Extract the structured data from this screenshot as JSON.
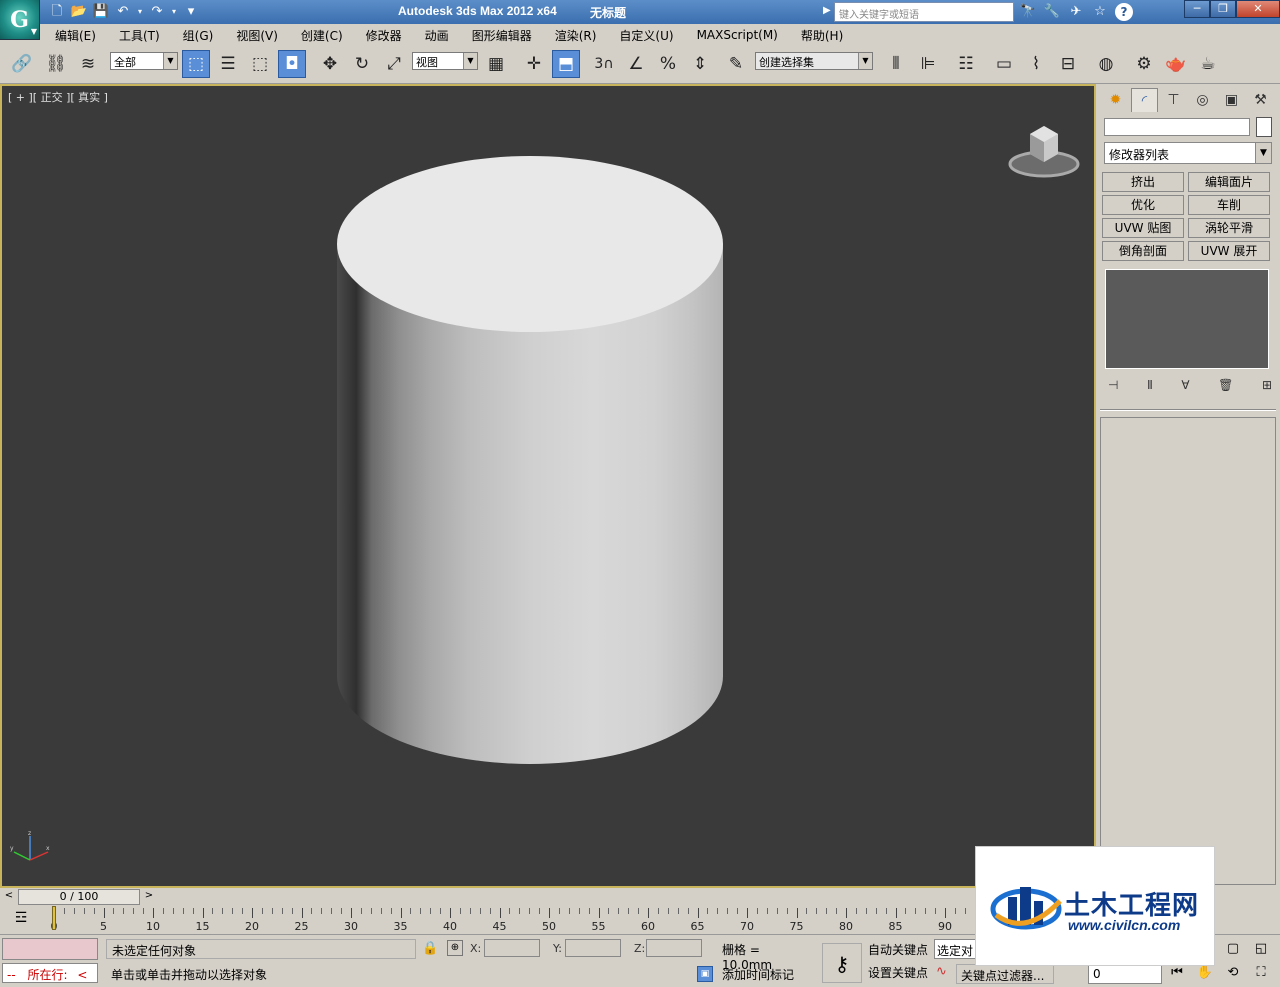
{
  "app": {
    "title": "Autodesk 3ds Max  2012 x64",
    "document": "无标题",
    "search_placeholder": "键入关键字或短语",
    "logo": "G"
  },
  "menu": [
    "编辑(E)",
    "工具(T)",
    "组(G)",
    "视图(V)",
    "创建(C)",
    "修改器",
    "动画",
    "图形编辑器",
    "渲染(R)",
    "自定义(U)",
    "MAXScript(M)",
    "帮助(H)"
  ],
  "toolbar": {
    "filter_value": "全部",
    "ref_coord_value": "视图",
    "named_selection_value": "创建选择集",
    "snap_value": "3"
  },
  "viewport": {
    "label": "[ + ][ 正交 ][ 真实 ]",
    "object": "cylinder",
    "background": "#3a3a3a",
    "active_border": "#c8b45a"
  },
  "command_panel": {
    "modifier_list": "修改器列表",
    "modifier_buttons": [
      "挤出",
      "编辑面片",
      "优化",
      "车削",
      "UVW 贴图",
      "涡轮平滑",
      "倒角剖面",
      "UVW 展开"
    ]
  },
  "timeline": {
    "position": "0 / 100",
    "current_frame": 0,
    "tick_labels": [
      "0",
      "5",
      "10",
      "15",
      "20",
      "25",
      "30",
      "35",
      "40",
      "45",
      "50",
      "55",
      "60",
      "65",
      "70",
      "75",
      "80",
      "85",
      "90"
    ]
  },
  "status": {
    "running_prefix": "--",
    "running_label": "所在行:",
    "running_suffix": "<",
    "prompt_selection": "未选定任何对象",
    "prompt_hint": "单击或单击并拖动以选择对象",
    "x_label": "X:",
    "y_label": "Y:",
    "z_label": "Z:",
    "grid": "栅格 = 10.0mm",
    "add_time_tag": "添加时间标记",
    "auto_key": "自动关键点",
    "set_key": "设置关键点",
    "selected_combo": "选定对",
    "key_filters": "关键点过滤器...",
    "frame_value": "0"
  },
  "watermark": {
    "name": "土木工程网",
    "url": "www.civilcn.com"
  }
}
